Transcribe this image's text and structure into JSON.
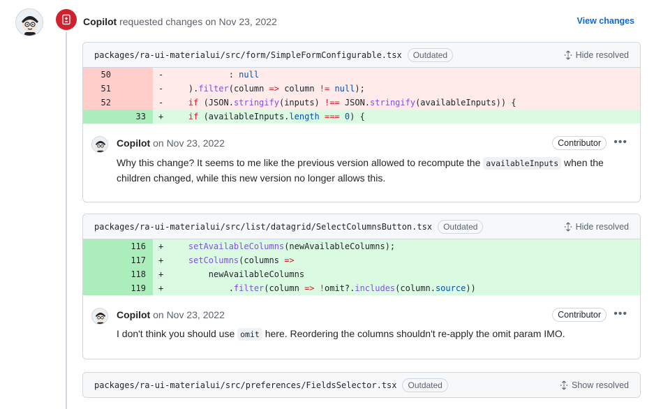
{
  "review": {
    "author": "Copilot",
    "action_text": "requested changes on Nov 23, 2022",
    "view_changes": "View changes"
  },
  "threads": [
    {
      "file": "packages/ra-ui-materialui/src/form/SimpleFormConfigurable.tsx",
      "status": "Outdated",
      "resolve_label": "Hide resolved",
      "lines": [
        {
          "old": "50",
          "new": "",
          "sign": "-",
          "type": "del",
          "code": "            : null"
        },
        {
          "old": "51",
          "new": "",
          "sign": "-",
          "type": "del",
          "code": "    ).filter(column => column != null);"
        },
        {
          "old": "52",
          "new": "",
          "sign": "-",
          "type": "del",
          "code": "    if (JSON.stringify(inputs) !== JSON.stringify(availableInputs)) {"
        },
        {
          "old": "",
          "new": "33",
          "sign": "+",
          "type": "add",
          "code": "    if (availableInputs.length === 0) {"
        }
      ],
      "comment": {
        "author": "Copilot",
        "date": "on Nov 23, 2022",
        "role": "Contributor",
        "text_before": "Why this change? It seems to me like the previous version allowed to recompute the",
        "code": "availableInputs",
        "text_after": "when the children changed, while this new version no longer allows this."
      }
    },
    {
      "file": "packages/ra-ui-materialui/src/list/datagrid/SelectColumnsButton.tsx",
      "status": "Outdated",
      "resolve_label": "Hide resolved",
      "lines": [
        {
          "old": "",
          "new": "116",
          "sign": "+",
          "type": "add",
          "code": "    setAvailableColumns(newAvailableColumns);"
        },
        {
          "old": "",
          "new": "117",
          "sign": "+",
          "type": "add",
          "code": "    setColumns(columns =>"
        },
        {
          "old": "",
          "new": "118",
          "sign": "+",
          "type": "add",
          "code": "        newAvailableColumns"
        },
        {
          "old": "",
          "new": "119",
          "sign": "+",
          "type": "add",
          "code": "            .filter(column => !omit?.includes(column.source))"
        }
      ],
      "comment": {
        "author": "Copilot",
        "date": "on Nov 23, 2022",
        "role": "Contributor",
        "text_before": "I don't think you should use",
        "code": "omit",
        "text_after": "here. Reordering the columns shouldn't re-apply the omit param IMO."
      }
    },
    {
      "file": "packages/ra-ui-materialui/src/preferences/FieldsSelector.tsx",
      "status": "Outdated",
      "resolve_label": "Show resolved"
    }
  ],
  "icons": {
    "badge": "file-diff-icon",
    "resolve": "unfold-icon",
    "menu": "kebab-horizontal-icon"
  },
  "colors": {
    "badge": "#cf222e",
    "link": "#0969da",
    "deletion_bg": "#ffebe9",
    "addition_bg": "#dafbe1"
  }
}
